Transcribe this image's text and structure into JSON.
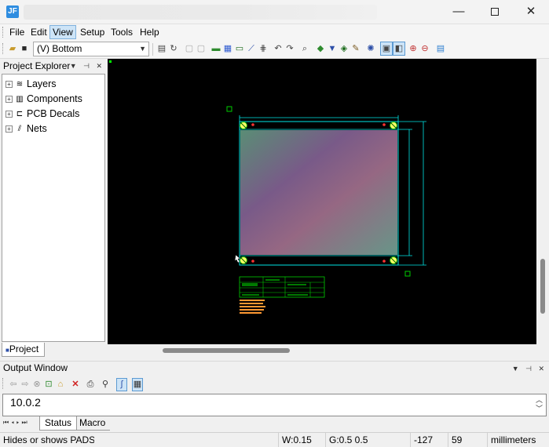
{
  "window": {
    "app_icon": "JF",
    "minimize_glyph": "—",
    "close_glyph": "✕"
  },
  "menu": {
    "items": [
      "File",
      "Edit",
      "View",
      "Setup",
      "Tools",
      "Help"
    ],
    "active": "View"
  },
  "toolbar": {
    "layer_select_value": "(V) Bottom",
    "icons": [
      "open-icon",
      "save-icon",
      "properties-icon",
      "redraw-icon",
      "select-mode-icon",
      "filter-icon",
      "add-component-icon",
      "add-pins-icon",
      "add-trace-icon",
      "dimension-icon",
      "grid-icon",
      "undo-icon",
      "redo-icon",
      "find-icon",
      "route-icon",
      "drc-icon",
      "3d-view-icon",
      "highlight-icon",
      "snap-icon",
      "display-toggle-icon",
      "split-view-icon",
      "zoom-in-icon",
      "zoom-out-icon",
      "layer-colors-icon"
    ]
  },
  "explorer": {
    "title": "Project Explorer",
    "items": [
      {
        "label": "Layers",
        "icon": "layers-icon"
      },
      {
        "label": "Components",
        "icon": "components-icon"
      },
      {
        "label": "PCB Decals",
        "icon": "pcb-decals-icon"
      },
      {
        "label": "Nets",
        "icon": "nets-icon"
      }
    ],
    "tab_label": "Project"
  },
  "output": {
    "title": "Output Window",
    "text": "10.0.2",
    "tabs": [
      "Status",
      "Macro"
    ],
    "active_tab": "Status"
  },
  "statusbar": {
    "hint": "Hides or shows PADS :",
    "width": "W:0.15",
    "grid": "G:0.5 0.5",
    "x": "-127",
    "y": "59",
    "units": "millimeters"
  },
  "colors": {
    "canvas": "#000000",
    "board_outline": "#00e5e5",
    "dimension": "#00e5e5",
    "pad_marker": "#ffff66",
    "title_block": "#00cc00",
    "notes_text": "#ff9933"
  }
}
